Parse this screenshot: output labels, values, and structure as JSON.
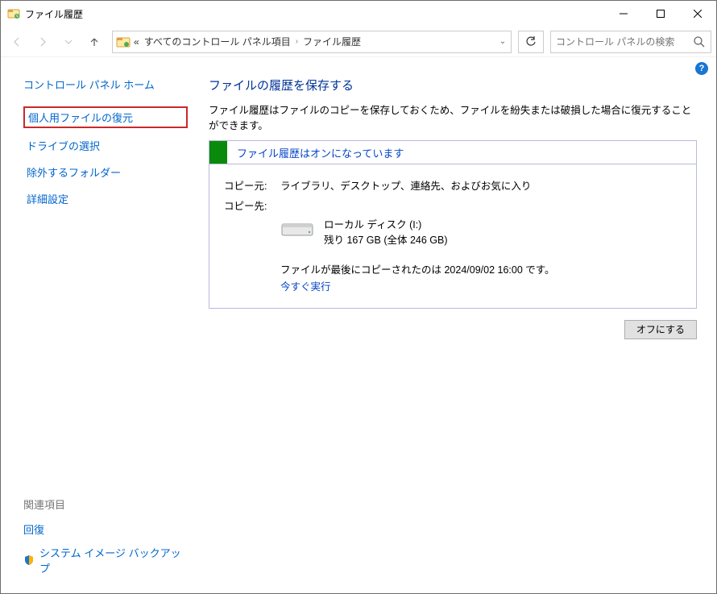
{
  "window": {
    "title": "ファイル履歴"
  },
  "breadcrumb": {
    "prefix": "«",
    "item1": "すべてのコントロール パネル項目",
    "item2": "ファイル履歴"
  },
  "search": {
    "placeholder": "コントロール パネルの検索"
  },
  "sidebar": {
    "home": "コントロール パネル ホーム",
    "links": [
      "個人用ファイルの復元",
      "ドライブの選択",
      "除外するフォルダー",
      "詳細設定"
    ],
    "related_title": "関連項目",
    "related": {
      "recovery": "回復",
      "backup": "システム イメージ バックアップ"
    }
  },
  "main": {
    "heading": "ファイルの履歴を保存する",
    "description": "ファイル履歴はファイルのコピーを保存しておくため、ファイルを紛失または破損した場合に復元することができます。",
    "status": "ファイル履歴はオンになっています",
    "copy_from_label": "コピー元:",
    "copy_from_value": "ライブラリ、デスクトップ、連絡先、およびお気に入り",
    "copy_to_label": "コピー先:",
    "disk_name": "ローカル ディスク (I:)",
    "disk_space": "残り 167 GB (全体 246 GB)",
    "last_copy": "ファイルが最後にコピーされたのは 2024/09/02 16:00 です。",
    "run_now": "今すぐ実行",
    "off_button": "オフにする"
  },
  "help": "?"
}
